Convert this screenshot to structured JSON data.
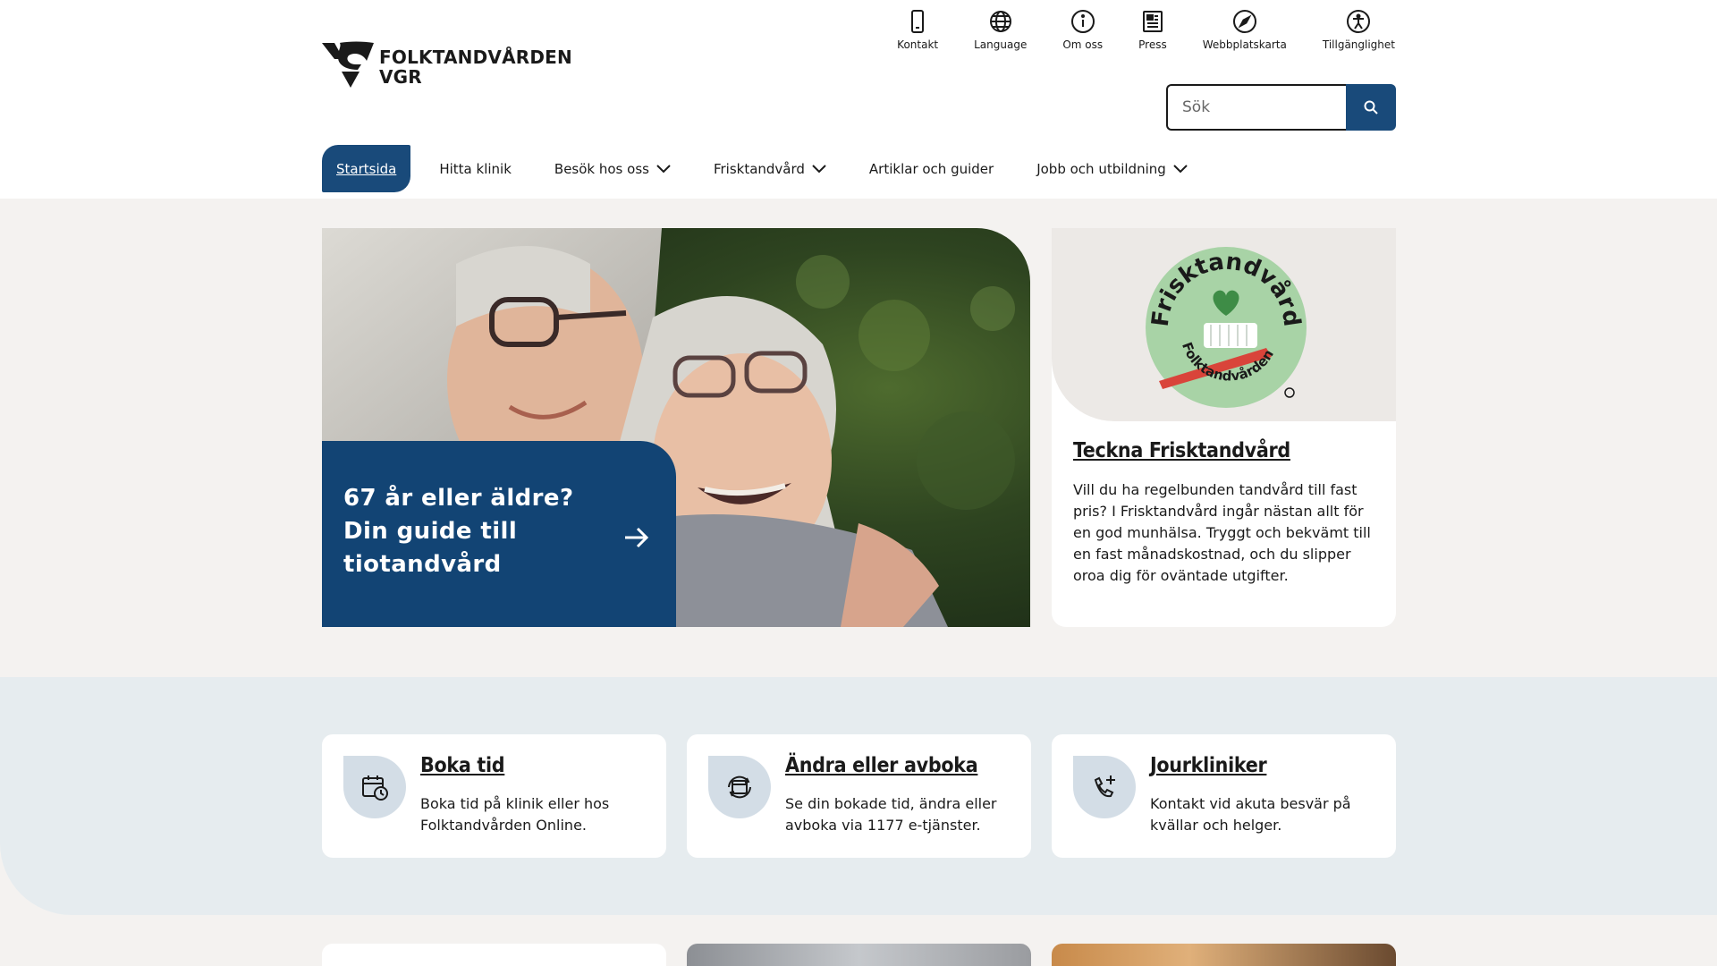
{
  "brand": {
    "line1": "FOLKTANDVÅRDEN",
    "line2": "VGR"
  },
  "utility_nav": [
    {
      "label": "Kontakt",
      "icon": "phone-icon"
    },
    {
      "label": "Language",
      "icon": "globe-icon"
    },
    {
      "label": "Om oss",
      "icon": "info-icon"
    },
    {
      "label": "Press",
      "icon": "newspaper-icon"
    },
    {
      "label": "Webbplatskarta",
      "icon": "compass-icon"
    },
    {
      "label": "Tillgänglighet",
      "icon": "accessibility-icon"
    }
  ],
  "search": {
    "placeholder": "Sök"
  },
  "main_nav": [
    {
      "label": "Startsida",
      "active": true
    },
    {
      "label": "Hitta klinik"
    },
    {
      "label": "Besök hos oss",
      "dropdown": true
    },
    {
      "label": "Frisktandvård",
      "dropdown": true
    },
    {
      "label": "Artiklar och guider"
    },
    {
      "label": "Jobb och utbildning",
      "dropdown": true
    }
  ],
  "hero": {
    "title": "67 år eller äldre? Din guide till tiotandvård"
  },
  "frisk_card": {
    "badge_top": "Frisktandvård",
    "badge_bottom": "Folktandvården",
    "title": "Teckna Frisktandvård",
    "text": "Vill du ha regelbunden tandvård till fast pris? I Frisktandvård ingår nästan allt för en god munhälsa. Tryggt och bekvämt till en fast månadskostnad, och du slipper oroa dig för oväntade utgifter."
  },
  "shortcuts": [
    {
      "title": "Boka tid",
      "text": "Boka tid på klinik eller hos Folktandvården Online.",
      "icon": "calendar-clock-icon"
    },
    {
      "title": "Ändra eller avboka",
      "text": "Se din bokade tid, ändra eller avboka via 1177 e-tjänster.",
      "icon": "calendar-refresh-icon"
    },
    {
      "title": "Jourkliniker",
      "text": "Kontakt vid akuta besvär på kvällar och helger.",
      "icon": "phone-plus-icon"
    }
  ],
  "colors": {
    "primary": "#194a7a",
    "hero_box": "#124474",
    "band": "#e6ecef",
    "page_bg": "#f4f2f0",
    "badge_green": "#a8d3a6"
  }
}
